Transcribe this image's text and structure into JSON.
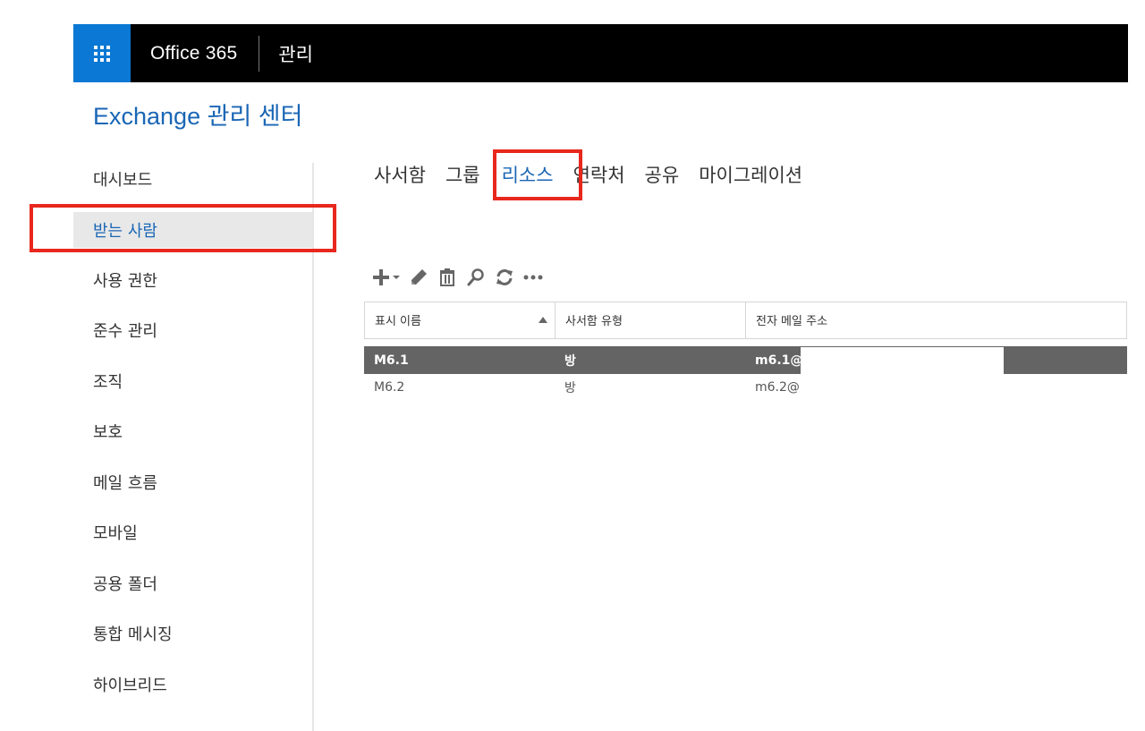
{
  "topbar": {
    "app_launcher_icon": "waffle-grid-icon",
    "brand": "Office 365",
    "section": "관리",
    "colors": {
      "launcher_bg": "#0a78d4",
      "bar_bg": "#000000"
    }
  },
  "page_title": "Exchange 관리 센터",
  "sidebar": {
    "items": [
      {
        "label": "대시보드"
      },
      {
        "label": "받는 사람",
        "active": true
      },
      {
        "label": "사용 권한"
      },
      {
        "label": "준수 관리"
      },
      {
        "label": "조직"
      },
      {
        "label": "보호"
      },
      {
        "label": "메일 흐름"
      },
      {
        "label": "모바일"
      },
      {
        "label": "공용 폴더"
      },
      {
        "label": "통합 메시징"
      },
      {
        "label": "하이브리드"
      }
    ]
  },
  "tabs": [
    {
      "label": "사서함"
    },
    {
      "label": "그룹"
    },
    {
      "label": "리소스",
      "active": true
    },
    {
      "label": "연락처"
    },
    {
      "label": "공유"
    },
    {
      "label": "마이그레이션"
    }
  ],
  "toolbar": {
    "icons": [
      "add-dropdown-icon",
      "edit-pencil-icon",
      "delete-trash-icon",
      "search-icon",
      "refresh-icon",
      "more-ellipsis-icon"
    ]
  },
  "table": {
    "columns": [
      "표시 이름",
      "사서함 유형",
      "전자 메일 주소"
    ],
    "sorted_column": "표시 이름",
    "sort_direction": "ascending",
    "rows": [
      {
        "name": "M6.1",
        "type": "방",
        "email": "m6.1@",
        "selected": true
      },
      {
        "name": "M6.2",
        "type": "방",
        "email": "m6.2@",
        "selected": false
      }
    ]
  },
  "annotations": {
    "highlight_color": "#e8271d"
  },
  "colors": {
    "accent": "#1a66b5",
    "selected_row": "#646464"
  }
}
